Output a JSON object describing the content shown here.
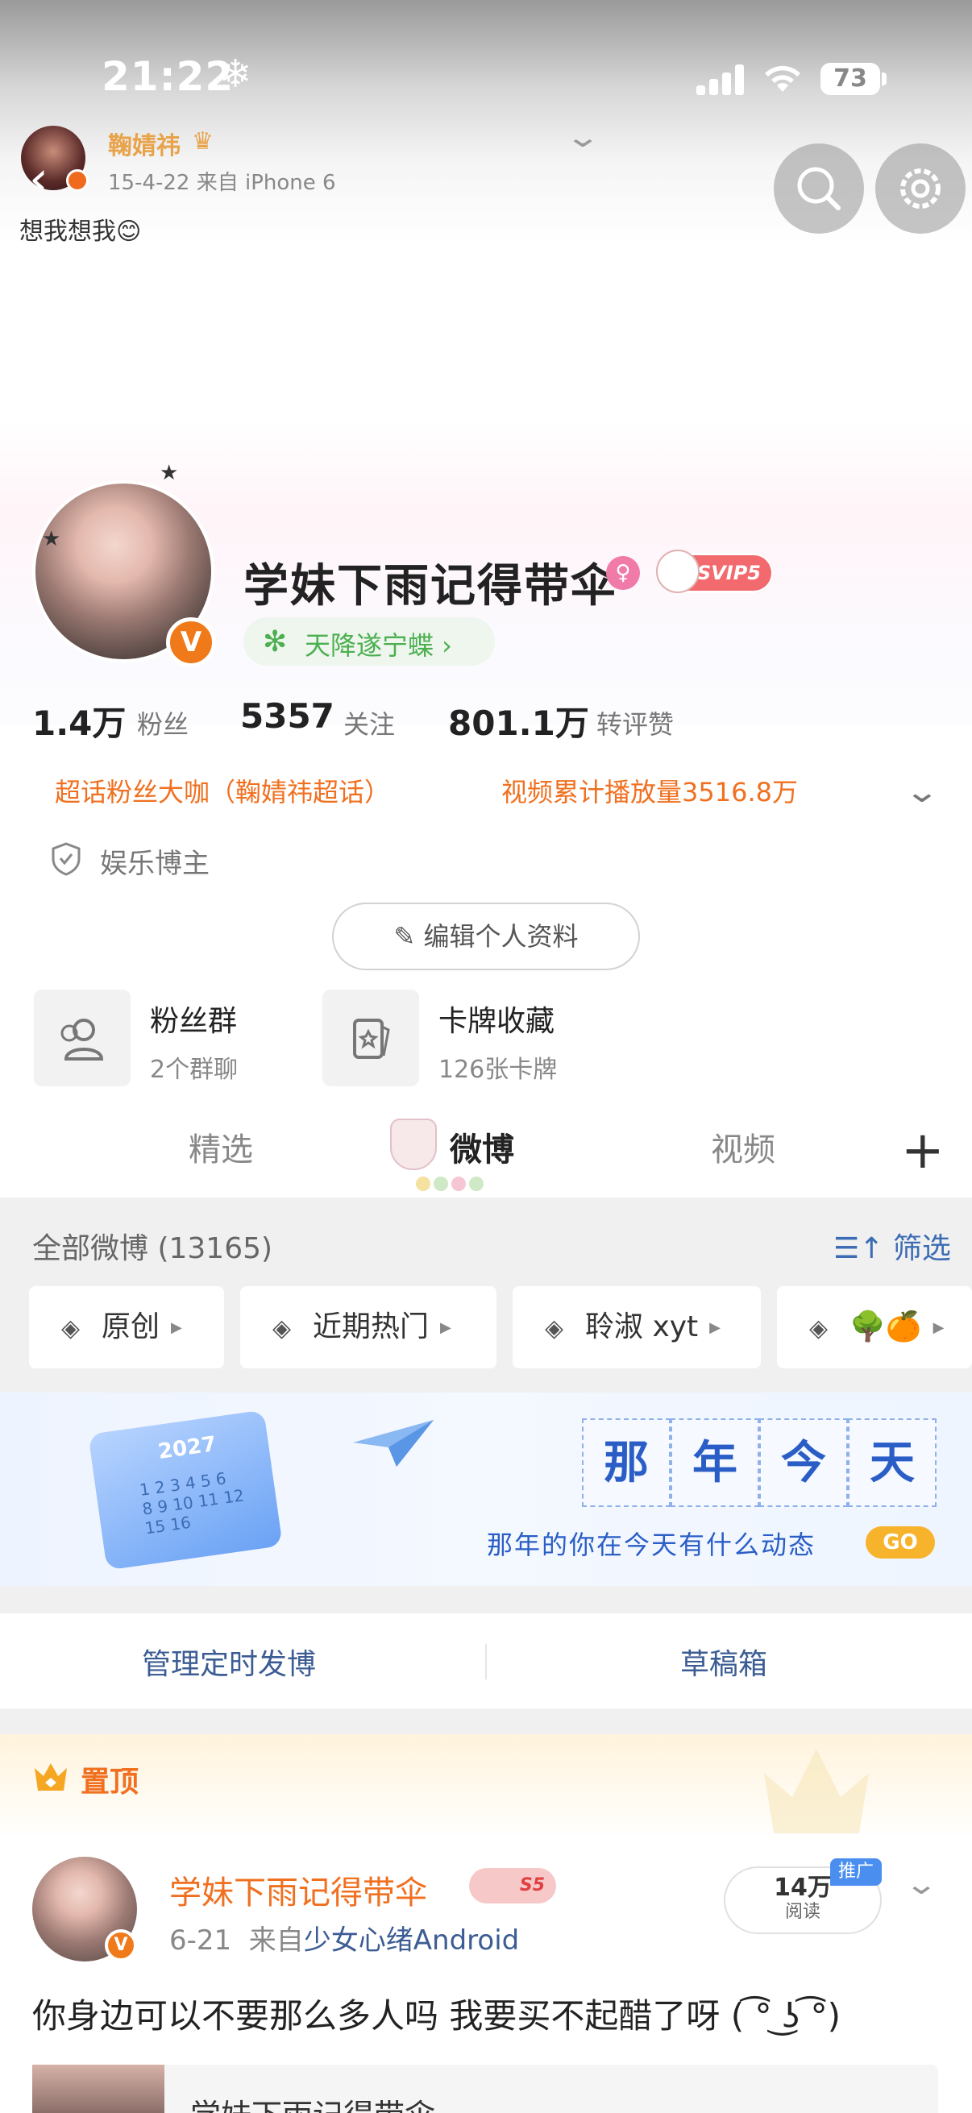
{
  "status": {
    "time": "21:22",
    "weather_icon": "snowflake-icon",
    "battery": "73"
  },
  "pinned_preview": {
    "name": "鞠婧祎",
    "meta": "15-4-22  来自 iPhone 6",
    "text": "想我想我😊"
  },
  "profile": {
    "name": "学妹下雨记得带伞",
    "svip_label": "SVIP5",
    "super_topic": "天降遂宁蝶 ›",
    "stats": [
      {
        "value": "1.4万",
        "label": "粉丝"
      },
      {
        "value": "5357",
        "label": "关注"
      },
      {
        "value": "801.1万",
        "label": "转评赞"
      }
    ],
    "pills": [
      "超话粉丝大咖（鞠婧祎超话）",
      "视频累计播放量3516.8万"
    ],
    "verify": "娱乐博主",
    "edit_button": "编辑个人资料",
    "cards": [
      {
        "title": "粉丝群",
        "sub": "2个群聊"
      },
      {
        "title": "卡牌收藏",
        "sub": "126张卡牌"
      }
    ]
  },
  "tabs": [
    "精选",
    "微博",
    "视频"
  ],
  "feed": {
    "all_label": "全部微博 (13165)",
    "filter_label": "筛选",
    "chips": [
      "原创",
      "近期热门",
      "聆淑 xyt",
      "🌳🍊"
    ],
    "banner": {
      "year": "2027",
      "nums": "1 2 3 4 5 6\n8 9 10 11 12\n15 16 ",
      "title_chars": [
        "那",
        "年",
        "今",
        "天"
      ],
      "subtitle": "那年的你在今天有什么动态",
      "go": "GO"
    },
    "manage_left": "管理定时发博",
    "manage_right": "草稿箱"
  },
  "post": {
    "pinned_label": "置顶",
    "author": "学妹下雨记得带伞",
    "level_badge": "S5",
    "date": "6-21",
    "source_prefix": "来自",
    "source": "少女心绪Android",
    "reads_value": "14万",
    "reads_label": "阅读",
    "promo_label": "推广",
    "text": "你身边可以不要那么多人吗 我要买不起醋了呀 (  ͡° ͜ʖ ͡°)",
    "quote_author": "学妹下雨记得带伞"
  },
  "colors": {
    "accent_orange": "#f07020",
    "link_blue": "#3c5c94",
    "super_green": "#4caf50"
  }
}
